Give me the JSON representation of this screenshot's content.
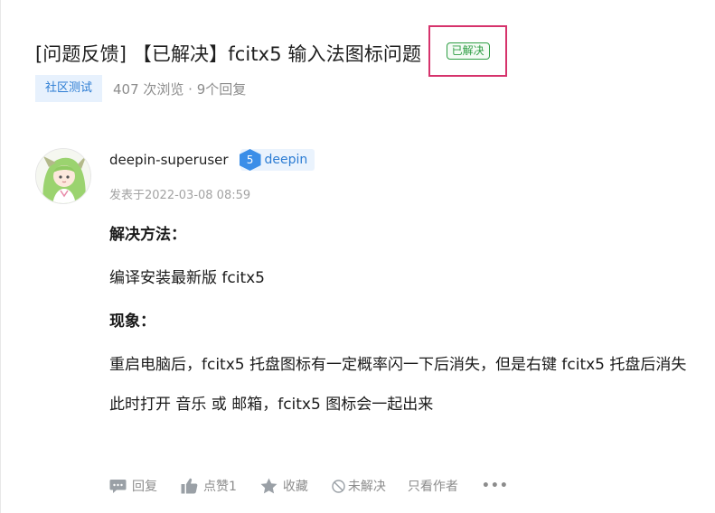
{
  "post": {
    "title": "[问题反馈] 【已解决】fcitx5 输入法图标问题",
    "status_badge": "已解决",
    "tag": "社区测试",
    "meta": "407 次浏览 · 9个回复"
  },
  "author": {
    "username": "deepin-superuser",
    "level": "5",
    "group": "deepin",
    "posted_at": "发表于2022-03-08 08:59"
  },
  "content": {
    "heading_solution": "解决方法：",
    "solution": "编译安装最新版 fcitx5",
    "heading_symptom": "现象：",
    "symptom_1": "重启电脑后，fcitx5 托盘图标有一定概率闪一下后消失，但是右键 fcitx5 托盘后消失",
    "symptom_2": "此时打开 音乐 或 邮箱，fcitx5 图标会一起出来"
  },
  "actions": {
    "reply": "回复",
    "like": "点赞1",
    "favorite": "收藏",
    "unsolved": "未解决",
    "author_only": "只看作者",
    "more": "•••"
  },
  "colors": {
    "accent": "#2b7cd3",
    "solved_green": "#2f9e44",
    "highlight_border": "#d6336c",
    "muted_text": "#8c8c8c"
  }
}
